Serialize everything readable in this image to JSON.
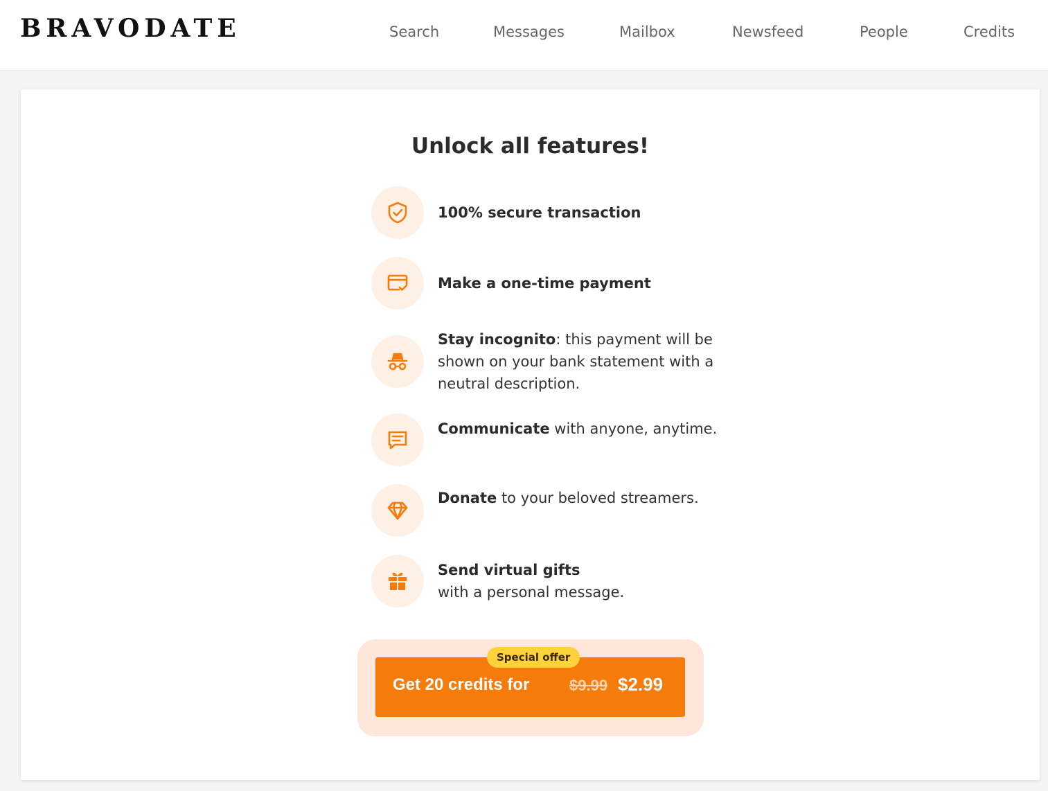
{
  "header": {
    "logo": "BRAVODATE",
    "nav": [
      {
        "label": "Search"
      },
      {
        "label": "Messages"
      },
      {
        "label": "Mailbox"
      },
      {
        "label": "Newsfeed"
      },
      {
        "label": "People"
      },
      {
        "label": "Credits"
      }
    ]
  },
  "main": {
    "title": "Unlock all features!",
    "features": [
      {
        "icon": "shield-check-icon",
        "bold": "100% secure transaction",
        "rest": ""
      },
      {
        "icon": "card-check-icon",
        "bold": "Make a one-time payment",
        "rest": ""
      },
      {
        "icon": "incognito-icon",
        "bold": "Stay incognito",
        "rest": ": this payment will be shown on your bank statement with a neutral description."
      },
      {
        "icon": "chat-icon",
        "bold": "Communicate",
        "rest": " with anyone, anytime."
      },
      {
        "icon": "diamond-icon",
        "bold": "Donate",
        "rest": " to your beloved streamers."
      },
      {
        "icon": "gift-icon",
        "bold": "Send virtual gifts",
        "rest": "with a personal message."
      }
    ],
    "offer": {
      "badge": "Special offer",
      "label": "Get 20 credits for",
      "old_price": "$9.99",
      "new_price": "$2.99"
    }
  },
  "colors": {
    "accent": "#f57c0a",
    "icon_bg": "#fff0e6",
    "badge": "#ffd23c"
  }
}
